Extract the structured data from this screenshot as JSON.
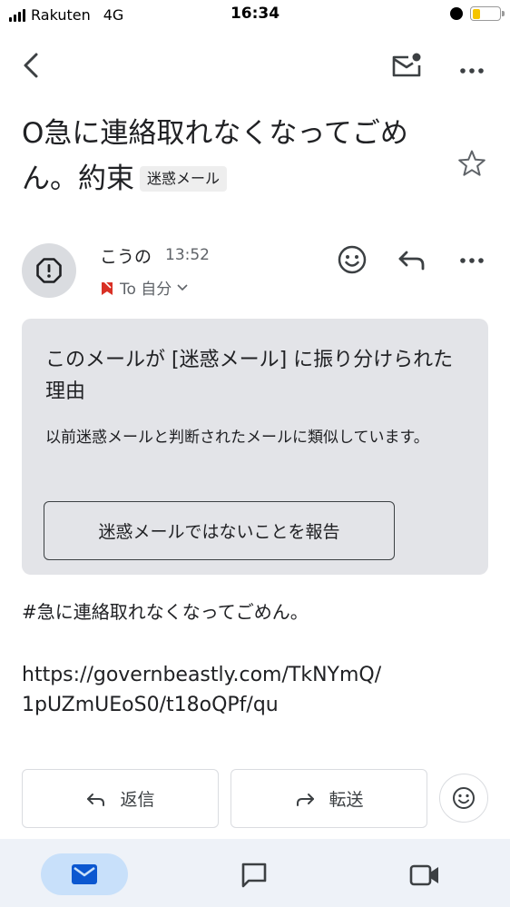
{
  "status_bar": {
    "carrier": "Rakuten",
    "network": "4G",
    "time": "16:34"
  },
  "email": {
    "subject_text": "O急に連絡取れなくなってごめん。約束",
    "label_chip": "迷惑メール",
    "sender_name": "こうの",
    "time": "13:52",
    "to_text": "To 自分"
  },
  "spam_card": {
    "title": "このメールが [迷惑メール] に振り分けられた理由",
    "body": "以前迷惑メールと判断されたメールに類似しています。",
    "button_label": "迷惑メールではないことを報告"
  },
  "body": {
    "line1": "#急に連絡取れなくなってごめん。",
    "link": "https://governbeastly.com/TkNYmQ/1pUZmUEoS0/t18oQPf/qu"
  },
  "actions": {
    "reply_label": "返信",
    "forward_label": "転送"
  },
  "colors": {
    "accent_blue": "#0b57d0",
    "card_bg": "#e3e4e8",
    "nav_bg": "#eef2f8",
    "nav_active": "#c8e0fa",
    "battery": "#f5c400",
    "spam_red": "#d93025"
  },
  "icons": [
    "back-icon",
    "mail-unread-icon",
    "more-icon",
    "star-icon",
    "spam-warning-icon",
    "emoji-icon",
    "reply-icon",
    "forward-icon",
    "mail-nav-icon",
    "chat-icon",
    "meet-icon"
  ]
}
